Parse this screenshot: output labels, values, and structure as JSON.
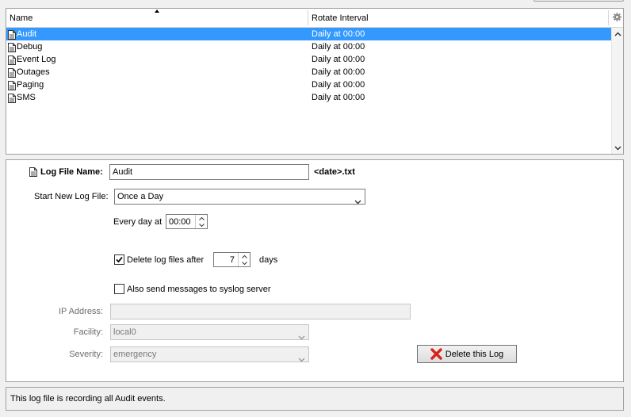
{
  "table": {
    "columns": {
      "name": "Name",
      "rotate_interval": "Rotate Interval"
    },
    "rows": [
      {
        "name": "Audit",
        "interval": "Daily at 00:00",
        "selected": true
      },
      {
        "name": "Debug",
        "interval": "Daily at 00:00",
        "selected": false
      },
      {
        "name": "Event Log",
        "interval": "Daily at 00:00",
        "selected": false
      },
      {
        "name": "Outages",
        "interval": "Daily at 00:00",
        "selected": false
      },
      {
        "name": "Paging",
        "interval": "Daily at 00:00",
        "selected": false
      },
      {
        "name": "SMS",
        "interval": "Daily at 00:00",
        "selected": false
      }
    ]
  },
  "details": {
    "log_file_name_label": "Log File Name:",
    "log_file_name_value": "Audit",
    "log_file_suffix": "<date>.txt",
    "start_new_label": "Start New Log File:",
    "start_new_value": "Once a Day",
    "every_day_label": "Every day at",
    "every_day_time": "00:00",
    "delete_after_label": "Delete log files after",
    "delete_after_checked": true,
    "delete_after_value": "7",
    "delete_after_unit": "days",
    "syslog_label": "Also send messages to syslog server",
    "syslog_checked": false,
    "ip_label": "IP Address:",
    "ip_value": "",
    "facility_label": "Facility:",
    "facility_value": "local0",
    "severity_label": "Severity:",
    "severity_value": "emergency",
    "delete_button_label": "Delete this Log"
  },
  "status": {
    "text": "This log file is recording all Audit events."
  },
  "colors": {
    "selection": "#3399ff",
    "delete_icon": "#d9221c"
  },
  "icons": {
    "file": "file-icon",
    "gear": "gear-icon",
    "delete": "red-x-icon"
  }
}
